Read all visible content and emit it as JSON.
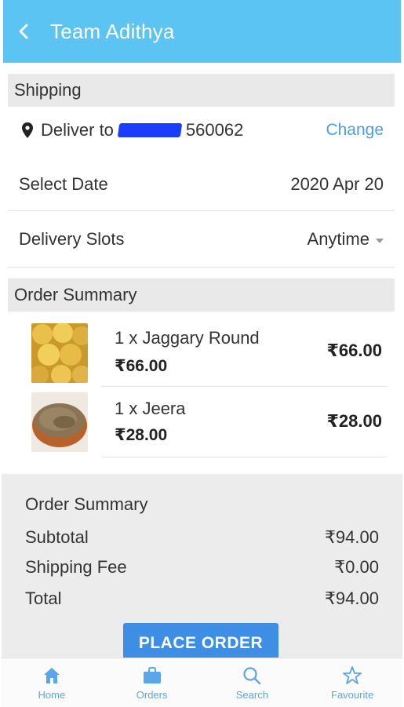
{
  "header": {
    "title": "Team Adithya"
  },
  "shipping": {
    "section_title": "Shipping",
    "deliver_prefix": "Deliver to",
    "pincode": "560062",
    "change_label": "Change",
    "select_date_label": "Select Date",
    "select_date_value": "2020 Apr 20",
    "delivery_slots_label": "Delivery Slots",
    "delivery_slots_value": "Anytime"
  },
  "order": {
    "section_title": "Order Summary",
    "items": [
      {
        "name": "1 x Jaggary Round",
        "price": "₹66.00",
        "total": "₹66.00"
      },
      {
        "name": "1 x Jeera",
        "price": "₹28.00",
        "total": "₹28.00"
      }
    ]
  },
  "summary": {
    "title": "Order Summary",
    "subtotal_label": "Subtotal",
    "subtotal_value": "₹94.00",
    "shipping_label": "Shipping Fee",
    "shipping_value": "₹0.00",
    "total_label": "Total",
    "total_value": "₹94.00",
    "place_order_label": "PLACE ORDER"
  },
  "nav": {
    "items": [
      {
        "label": "Home",
        "icon": "home-icon"
      },
      {
        "label": "Orders",
        "icon": "briefcase-icon"
      },
      {
        "label": "Search",
        "icon": "search-icon"
      },
      {
        "label": "Favourite",
        "icon": "star-icon"
      }
    ]
  },
  "colors": {
    "header": "#5bc4f2",
    "accent": "#3f8ee6",
    "nav": "#5aa6e8",
    "link": "#4a9ee8"
  }
}
